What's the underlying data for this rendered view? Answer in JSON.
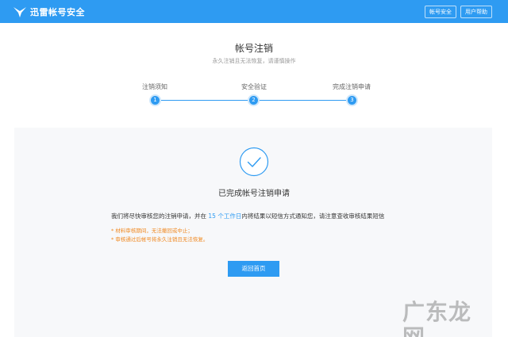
{
  "header": {
    "brand_name": "迅雷帐号安全",
    "nav_security": "帐号安全",
    "nav_help": "用户帮助"
  },
  "page": {
    "title": "帐号注销",
    "subtitle": "永久注销且无法恢复，请谨慎操作"
  },
  "steps": [
    {
      "label": "注销须知",
      "number": "1"
    },
    {
      "label": "安全验证",
      "number": "2"
    },
    {
      "label": "完成注销申请",
      "number": "3"
    }
  ],
  "result": {
    "title": "已完成帐号注销申请",
    "notice_before": "我们将尽快审核您的注销申请，并在 ",
    "notice_highlight": "15 个工作日",
    "notice_after": "内将结果以短信方式通知您，请注意查收审核结果短信",
    "warnings": [
      "* 材料审核期间，无法撤回或中止；",
      "* 审核通过后帐号将永久注销且无法恢复。"
    ],
    "home_button": "返回首页"
  },
  "watermark": "广东龙网",
  "colors": {
    "accent": "#2e9bf2",
    "warning": "#f08a24",
    "panel_bg": "#f7f8fa"
  }
}
